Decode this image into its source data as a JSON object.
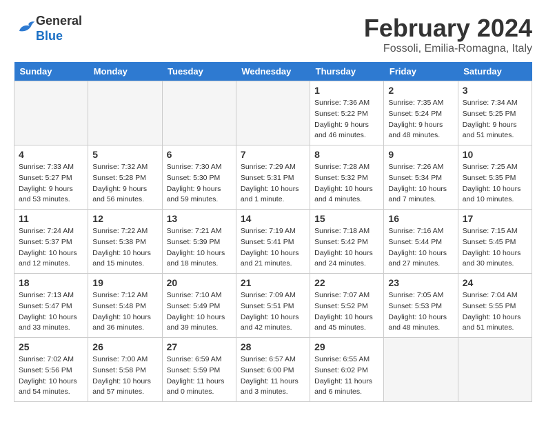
{
  "header": {
    "logo_general": "General",
    "logo_blue": "Blue",
    "month_title": "February 2024",
    "location": "Fossoli, Emilia-Romagna, Italy"
  },
  "days_of_week": [
    "Sunday",
    "Monday",
    "Tuesday",
    "Wednesday",
    "Thursday",
    "Friday",
    "Saturday"
  ],
  "weeks": [
    [
      {
        "day": "",
        "info": ""
      },
      {
        "day": "",
        "info": ""
      },
      {
        "day": "",
        "info": ""
      },
      {
        "day": "",
        "info": ""
      },
      {
        "day": "1",
        "info": "Sunrise: 7:36 AM\nSunset: 5:22 PM\nDaylight: 9 hours\nand 46 minutes."
      },
      {
        "day": "2",
        "info": "Sunrise: 7:35 AM\nSunset: 5:24 PM\nDaylight: 9 hours\nand 48 minutes."
      },
      {
        "day": "3",
        "info": "Sunrise: 7:34 AM\nSunset: 5:25 PM\nDaylight: 9 hours\nand 51 minutes."
      }
    ],
    [
      {
        "day": "4",
        "info": "Sunrise: 7:33 AM\nSunset: 5:27 PM\nDaylight: 9 hours\nand 53 minutes."
      },
      {
        "day": "5",
        "info": "Sunrise: 7:32 AM\nSunset: 5:28 PM\nDaylight: 9 hours\nand 56 minutes."
      },
      {
        "day": "6",
        "info": "Sunrise: 7:30 AM\nSunset: 5:30 PM\nDaylight: 9 hours\nand 59 minutes."
      },
      {
        "day": "7",
        "info": "Sunrise: 7:29 AM\nSunset: 5:31 PM\nDaylight: 10 hours\nand 1 minute."
      },
      {
        "day": "8",
        "info": "Sunrise: 7:28 AM\nSunset: 5:32 PM\nDaylight: 10 hours\nand 4 minutes."
      },
      {
        "day": "9",
        "info": "Sunrise: 7:26 AM\nSunset: 5:34 PM\nDaylight: 10 hours\nand 7 minutes."
      },
      {
        "day": "10",
        "info": "Sunrise: 7:25 AM\nSunset: 5:35 PM\nDaylight: 10 hours\nand 10 minutes."
      }
    ],
    [
      {
        "day": "11",
        "info": "Sunrise: 7:24 AM\nSunset: 5:37 PM\nDaylight: 10 hours\nand 12 minutes."
      },
      {
        "day": "12",
        "info": "Sunrise: 7:22 AM\nSunset: 5:38 PM\nDaylight: 10 hours\nand 15 minutes."
      },
      {
        "day": "13",
        "info": "Sunrise: 7:21 AM\nSunset: 5:39 PM\nDaylight: 10 hours\nand 18 minutes."
      },
      {
        "day": "14",
        "info": "Sunrise: 7:19 AM\nSunset: 5:41 PM\nDaylight: 10 hours\nand 21 minutes."
      },
      {
        "day": "15",
        "info": "Sunrise: 7:18 AM\nSunset: 5:42 PM\nDaylight: 10 hours\nand 24 minutes."
      },
      {
        "day": "16",
        "info": "Sunrise: 7:16 AM\nSunset: 5:44 PM\nDaylight: 10 hours\nand 27 minutes."
      },
      {
        "day": "17",
        "info": "Sunrise: 7:15 AM\nSunset: 5:45 PM\nDaylight: 10 hours\nand 30 minutes."
      }
    ],
    [
      {
        "day": "18",
        "info": "Sunrise: 7:13 AM\nSunset: 5:47 PM\nDaylight: 10 hours\nand 33 minutes."
      },
      {
        "day": "19",
        "info": "Sunrise: 7:12 AM\nSunset: 5:48 PM\nDaylight: 10 hours\nand 36 minutes."
      },
      {
        "day": "20",
        "info": "Sunrise: 7:10 AM\nSunset: 5:49 PM\nDaylight: 10 hours\nand 39 minutes."
      },
      {
        "day": "21",
        "info": "Sunrise: 7:09 AM\nSunset: 5:51 PM\nDaylight: 10 hours\nand 42 minutes."
      },
      {
        "day": "22",
        "info": "Sunrise: 7:07 AM\nSunset: 5:52 PM\nDaylight: 10 hours\nand 45 minutes."
      },
      {
        "day": "23",
        "info": "Sunrise: 7:05 AM\nSunset: 5:53 PM\nDaylight: 10 hours\nand 48 minutes."
      },
      {
        "day": "24",
        "info": "Sunrise: 7:04 AM\nSunset: 5:55 PM\nDaylight: 10 hours\nand 51 minutes."
      }
    ],
    [
      {
        "day": "25",
        "info": "Sunrise: 7:02 AM\nSunset: 5:56 PM\nDaylight: 10 hours\nand 54 minutes."
      },
      {
        "day": "26",
        "info": "Sunrise: 7:00 AM\nSunset: 5:58 PM\nDaylight: 10 hours\nand 57 minutes."
      },
      {
        "day": "27",
        "info": "Sunrise: 6:59 AM\nSunset: 5:59 PM\nDaylight: 11 hours\nand 0 minutes."
      },
      {
        "day": "28",
        "info": "Sunrise: 6:57 AM\nSunset: 6:00 PM\nDaylight: 11 hours\nand 3 minutes."
      },
      {
        "day": "29",
        "info": "Sunrise: 6:55 AM\nSunset: 6:02 PM\nDaylight: 11 hours\nand 6 minutes."
      },
      {
        "day": "",
        "info": ""
      },
      {
        "day": "",
        "info": ""
      }
    ]
  ]
}
